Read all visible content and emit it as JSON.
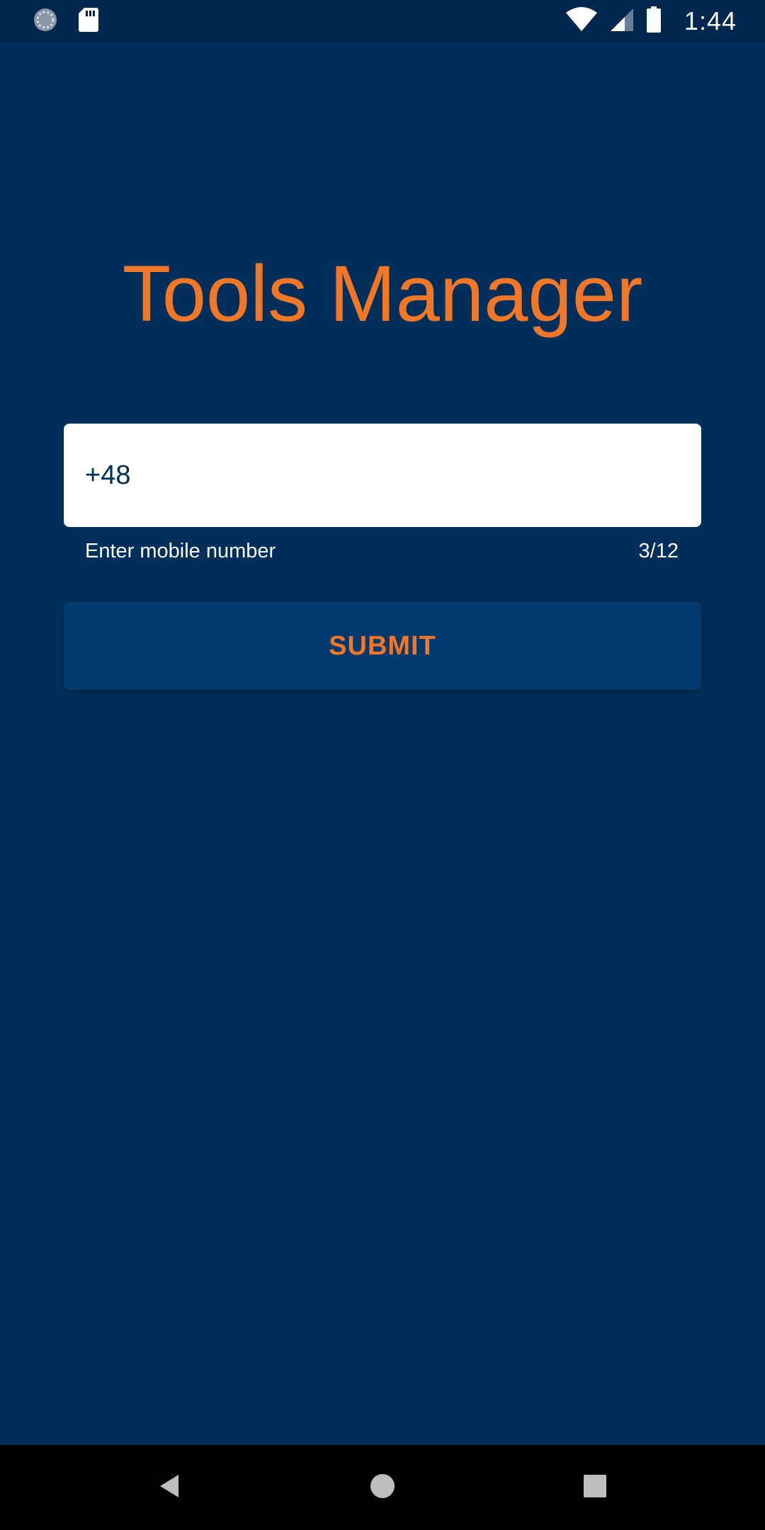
{
  "status_bar": {
    "time": "1:44",
    "icons": [
      "sync-icon",
      "sd-card-icon",
      "wifi-icon",
      "cell-signal-icon",
      "battery-icon"
    ]
  },
  "app": {
    "title": "Tools Manager"
  },
  "form": {
    "phone_value": "+48",
    "helper_text": "Enter mobile number",
    "char_counter": "3/12",
    "submit_label": "SUBMIT"
  },
  "nav_bar": {
    "icons": [
      "back-icon",
      "home-icon",
      "recents-icon"
    ]
  },
  "colors": {
    "background": "#002f5c",
    "status_bar": "#00284f",
    "accent": "#f07728",
    "button": "#043a6e",
    "input_bg": "#ffffff"
  }
}
